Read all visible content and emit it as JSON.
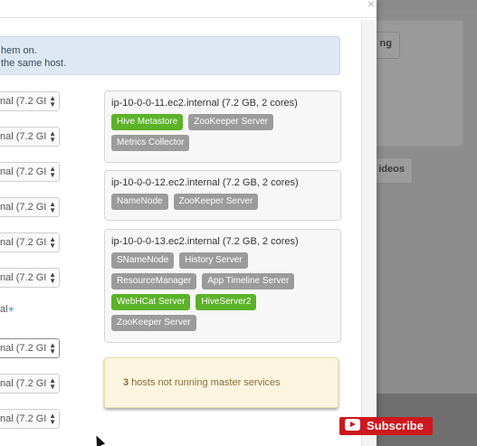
{
  "background": {
    "button_1_label": "ng",
    "button_2_label": "ideos"
  },
  "modal": {
    "close_glyph": "×",
    "info_line_1": "hem on.",
    "info_line_2": "the same host.",
    "selects": [
      {
        "value": "nal (7.2 GI"
      },
      {
        "value": "nal (7.2 GI"
      },
      {
        "value": "nal (7.2 GI"
      },
      {
        "value": "nal (7.2 GI"
      },
      {
        "value": "nal (7.2 GI"
      },
      {
        "value": "nal (7.2 GI"
      },
      {
        "value": "nal (7.2 GI"
      },
      {
        "value": "nal (7.2 GI"
      },
      {
        "value": "nal (7.2 GI"
      }
    ],
    "loose_text": "al",
    "loose_icon": "✳",
    "hosts": [
      {
        "title": "ip-10-0-0-11.ec2.internal (7.2 GB, 2 cores)",
        "components": [
          {
            "label": "Hive Metastore",
            "color": "green"
          },
          {
            "label": "ZooKeeper Server",
            "color": "grey"
          },
          {
            "label": "Metrics Collector",
            "color": "grey"
          }
        ]
      },
      {
        "title": "ip-10-0-0-12.ec2.internal (7.2 GB, 2 cores)",
        "components": [
          {
            "label": "NameNode",
            "color": "grey"
          },
          {
            "label": "ZooKeeper Server",
            "color": "grey"
          }
        ]
      },
      {
        "title": "ip-10-0-0-13.ec2.internal (7.2 GB, 2 cores)",
        "components": [
          {
            "label": "SNameNode",
            "color": "grey"
          },
          {
            "label": "History Server",
            "color": "grey"
          },
          {
            "label": "ResourceManager",
            "color": "grey"
          },
          {
            "label": "App Timeline Server",
            "color": "grey"
          },
          {
            "label": "WebHCat Server",
            "color": "green"
          },
          {
            "label": "HiveServer2",
            "color": "green"
          },
          {
            "label": "ZooKeeper Server",
            "color": "grey"
          }
        ]
      }
    ],
    "warning_count": "3",
    "warning_text": "hosts not running master services"
  },
  "overlay": {
    "subscribe_label": "Subscribe"
  },
  "colors": {
    "green_badge": "#5cb228",
    "grey_badge": "#9b9b9b",
    "info_bg": "#dde8f3",
    "warning_bg": "#fcf5df",
    "subscribe_red": "#cc181e"
  }
}
